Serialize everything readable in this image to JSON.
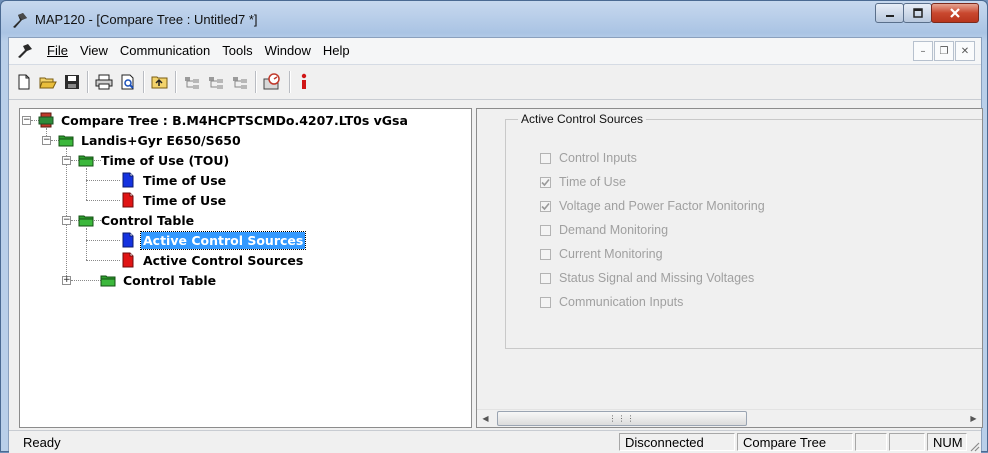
{
  "window": {
    "title": "MAP120 - [Compare Tree : Untitled7 *]",
    "app_icon": "map120-app-icon",
    "caption_buttons": [
      "minimize-icon",
      "maximize-icon",
      "close-icon"
    ]
  },
  "menubar": {
    "items": [
      {
        "label": "File"
      },
      {
        "label": "View"
      },
      {
        "label": "Communication"
      },
      {
        "label": "Tools"
      },
      {
        "label": "Window"
      },
      {
        "label": "Help"
      }
    ],
    "mdi_buttons": [
      "mdi-minimize-icon",
      "mdi-restore-icon",
      "mdi-close-icon"
    ]
  },
  "toolbar": {
    "buttons": [
      "new-icon",
      "open-icon",
      "save-icon",
      "print-icon",
      "print-preview-icon",
      "up-folder-icon",
      "tree-icon-1",
      "tree-icon-2",
      "tree-icon-3",
      "device-icon",
      "info-icon"
    ]
  },
  "tree": {
    "nodes": [
      {
        "label": "Compare Tree : B.M4HCPTSCMDo.4207.LT0s vGsa",
        "icon": "compare-tree-icon"
      },
      {
        "label": "Landis+Gyr E650/S650",
        "icon": "green-folder-icon"
      },
      {
        "label": "Time of Use (TOU)",
        "icon": "green-folder-icon"
      },
      {
        "label": "Time of Use",
        "icon": "blue-document-icon"
      },
      {
        "label": "Time of Use",
        "icon": "red-document-icon"
      },
      {
        "label": "Control Table",
        "icon": "green-folder-icon"
      },
      {
        "label": "Active Control Sources",
        "icon": "blue-document-icon",
        "selected": true
      },
      {
        "label": "Active Control Sources",
        "icon": "red-document-icon"
      },
      {
        "label": "Control Table",
        "icon": "green-folder-icon"
      }
    ]
  },
  "panel": {
    "group_title": "Active Control Sources",
    "checkboxes": [
      {
        "label": "Control Inputs",
        "checked": false
      },
      {
        "label": "Time of Use",
        "checked": true
      },
      {
        "label": "Voltage and Power Factor Monitoring",
        "checked": true
      },
      {
        "label": "Demand Monitoring",
        "checked": false
      },
      {
        "label": "Current Monitoring",
        "checked": false
      },
      {
        "label": "Status Signal and Missing Voltages",
        "checked": false
      },
      {
        "label": "Communication Inputs",
        "checked": false
      }
    ]
  },
  "statusbar": {
    "ready": "Ready",
    "connection": "Disconnected",
    "view": "Compare Tree",
    "num": "NUM"
  },
  "colors": {
    "selection": "#3399ff",
    "folder_green": "#3aa53a",
    "doc_blue": "#1432e0",
    "doc_red": "#e01414",
    "disabled_text": "#a0a0a0"
  }
}
